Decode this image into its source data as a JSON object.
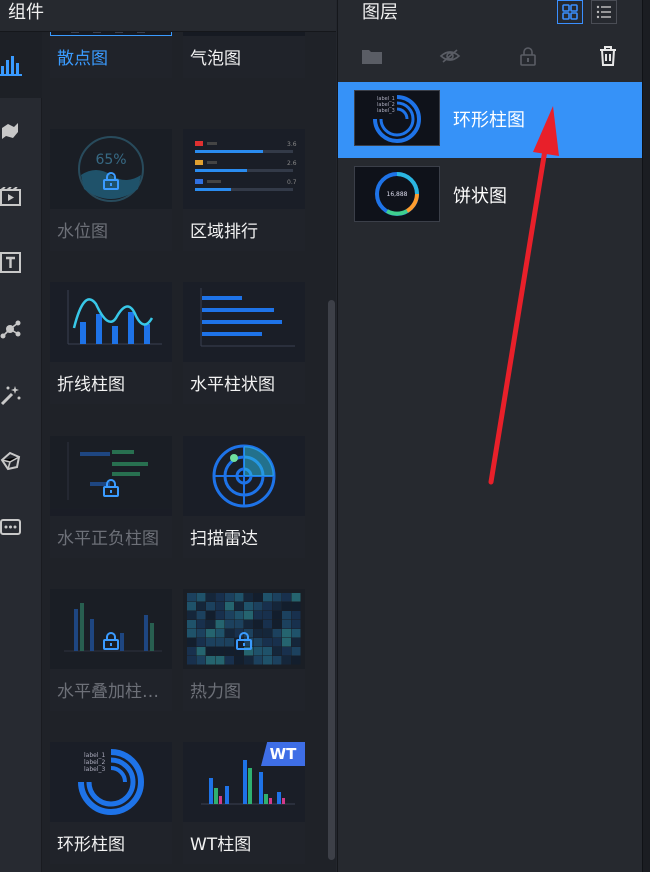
{
  "left_panel": {
    "title": "组件",
    "rail_icons": [
      "bar-chart-icon",
      "map-icon",
      "media-icon",
      "text-icon",
      "relation-icon",
      "magic-icon",
      "shape-icon",
      "more-icon"
    ],
    "cards": [
      {
        "label": "散点图",
        "state": "selected"
      },
      {
        "label": "气泡图",
        "state": "normal"
      },
      {
        "label": "水位图",
        "state": "locked"
      },
      {
        "label": "区域排行",
        "state": "normal"
      },
      {
        "label": "折线柱图",
        "state": "normal"
      },
      {
        "label": "水平柱状图",
        "state": "normal"
      },
      {
        "label": "水平正负柱图",
        "state": "locked"
      },
      {
        "label": "扫描雷达",
        "state": "normal"
      },
      {
        "label": "水平叠加柱…",
        "state": "locked"
      },
      {
        "label": "热力图",
        "state": "locked"
      },
      {
        "label": "环形柱图",
        "state": "normal"
      },
      {
        "label": "WT柱图",
        "state": "normal",
        "badge": "WT"
      }
    ],
    "thumb_text": {
      "water_level_percent": "65%",
      "rank_values": [
        "3.6",
        "2.6",
        "0.7"
      ],
      "ring_labels": [
        "label_1",
        "label_2",
        "label_3"
      ]
    }
  },
  "right_panel": {
    "title": "图层",
    "layers": [
      {
        "name": "环形柱图",
        "active": true,
        "thumb_labels": [
          "label_1",
          "label_2",
          "label_3"
        ]
      },
      {
        "name": "饼状图",
        "active": false,
        "thumb_value": "16,888"
      }
    ]
  },
  "colors": {
    "accent": "#3692f8",
    "selected_text": "#3a9bff",
    "arrow": "#e8202a"
  }
}
